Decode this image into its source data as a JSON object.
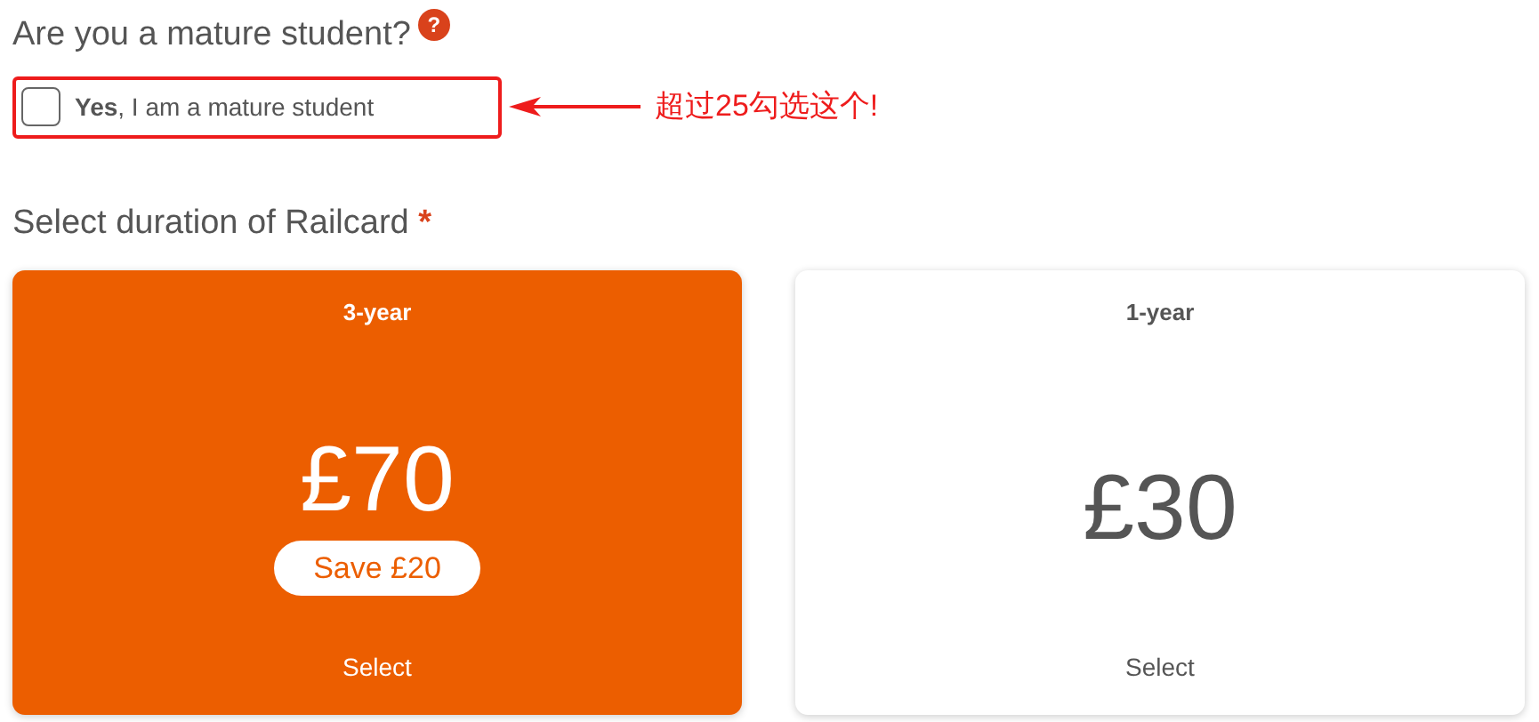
{
  "question": {
    "text": "Are you a mature student?",
    "help": "?"
  },
  "mature_checkbox": {
    "label": "**Yes**, I am a mature student",
    "checked": false
  },
  "annotation": {
    "text": "超过25勾选这个!"
  },
  "duration": {
    "title": "Select duration of Railcard",
    "required_mark": "*"
  },
  "options": [
    {
      "title": "3-year",
      "price": "£70",
      "saving": "Save £20",
      "action": "Select",
      "selected": true
    },
    {
      "title": "1-year",
      "price": "£30",
      "action": "Select",
      "selected": false
    }
  ]
}
